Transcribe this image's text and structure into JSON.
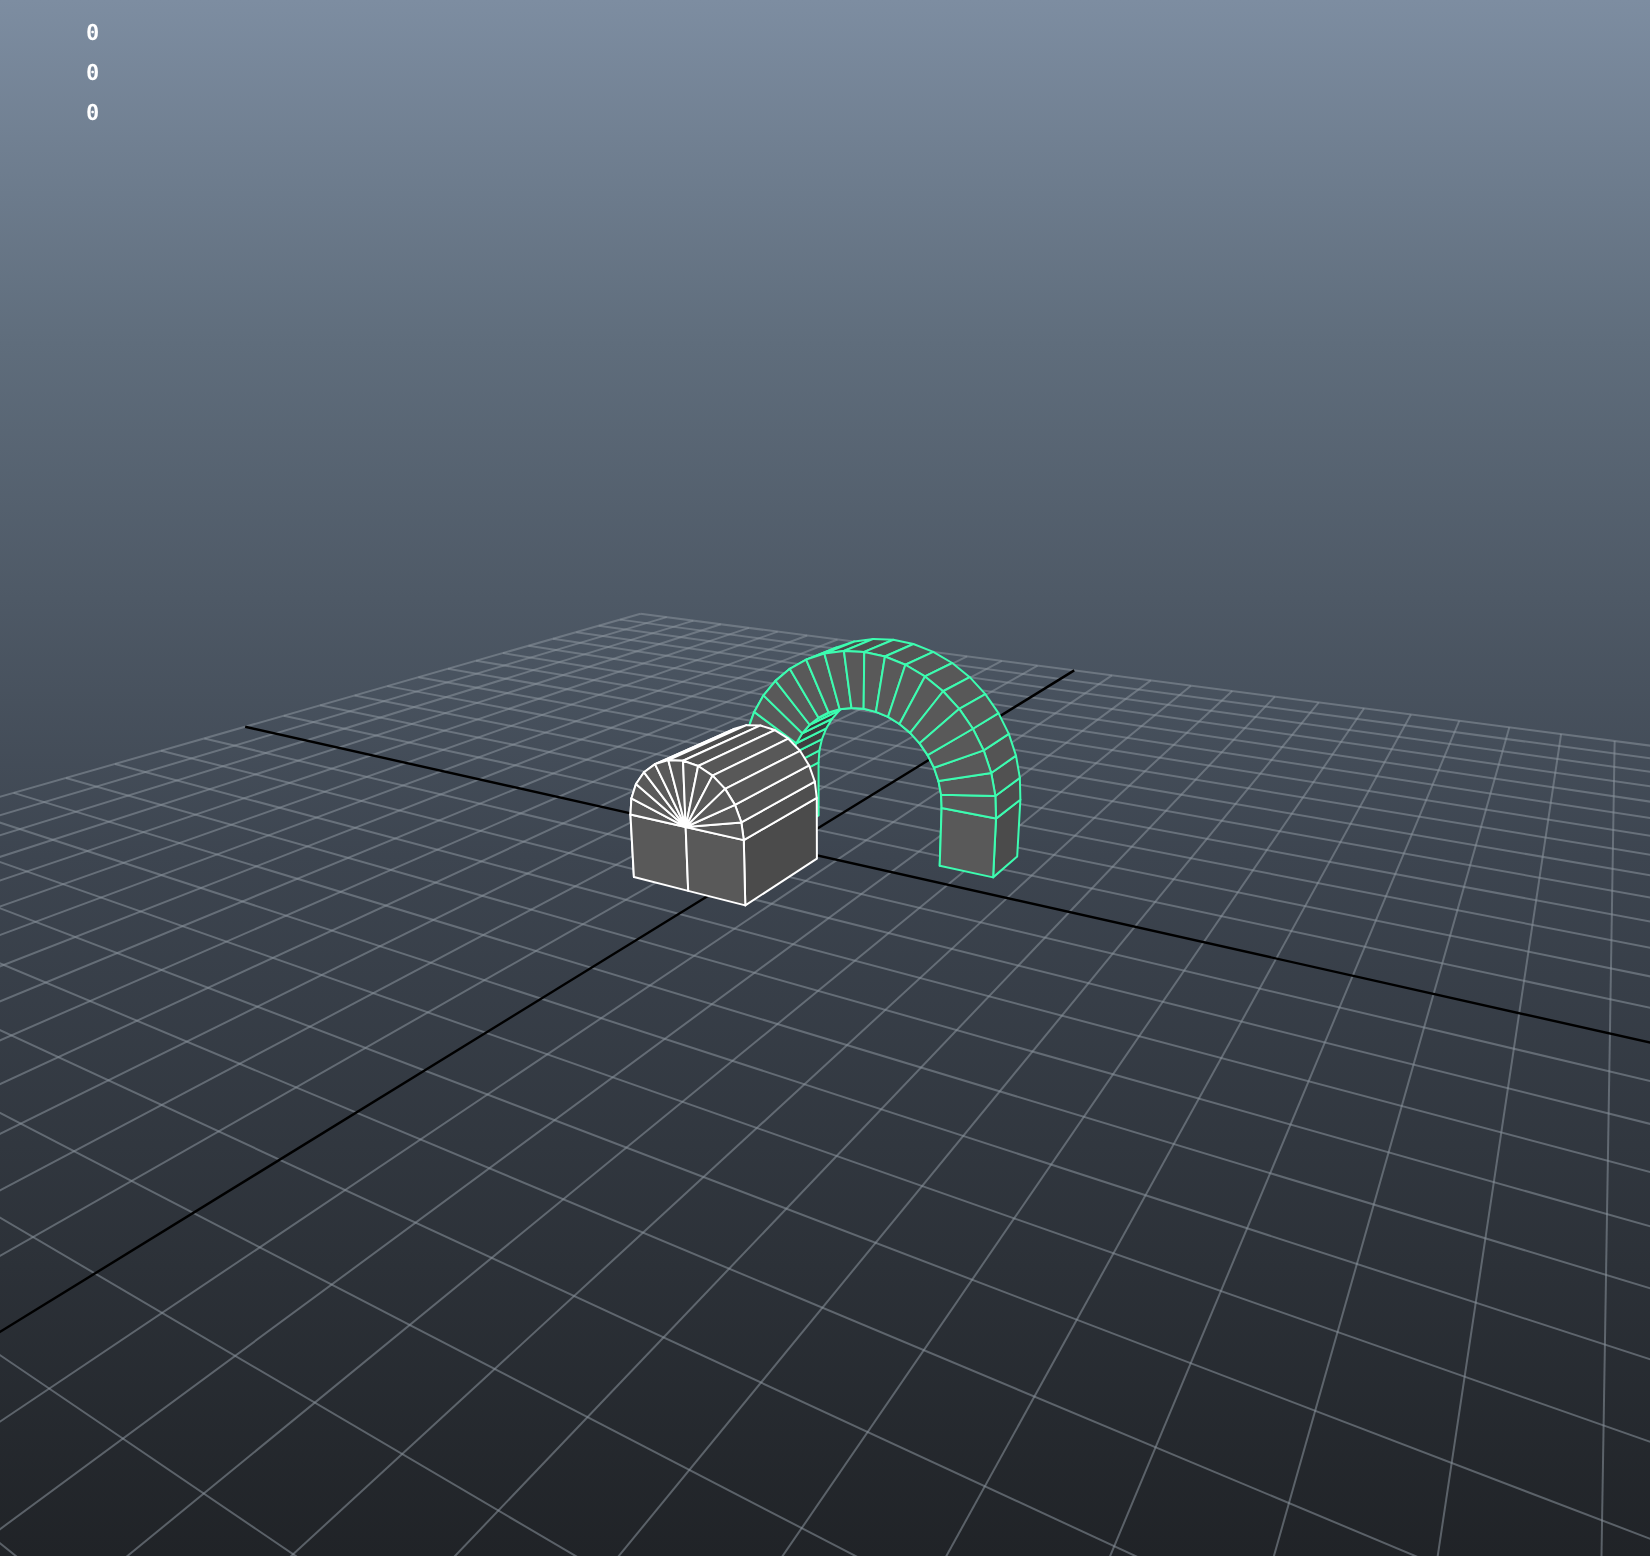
{
  "viewport": {
    "hud_readouts": [
      "0",
      "0",
      "0"
    ]
  }
}
